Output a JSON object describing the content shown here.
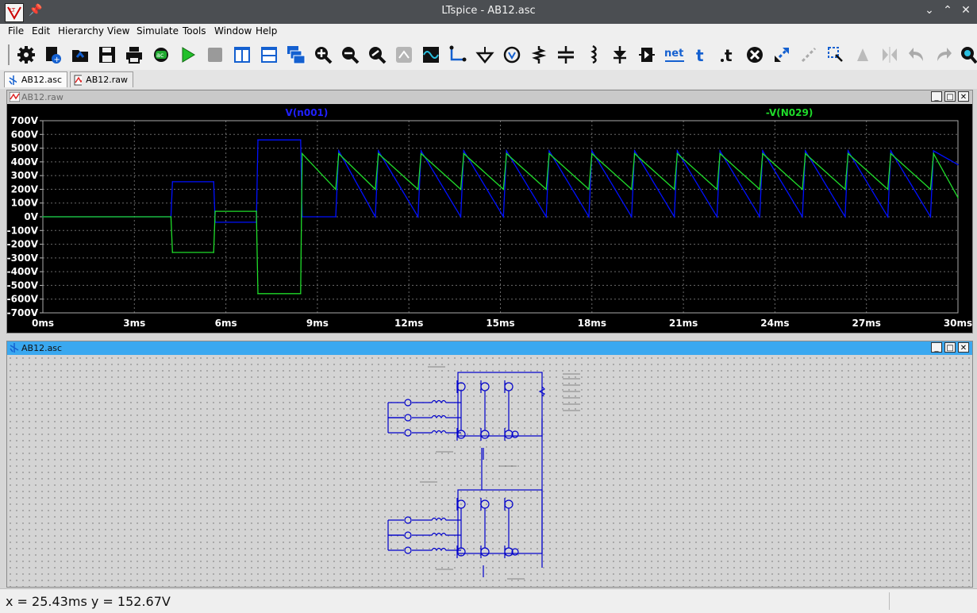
{
  "window": {
    "title": "LTspice - AB12.asc"
  },
  "menu": [
    "File",
    "Edit",
    "Hierarchy",
    "View",
    "Simulate",
    "Tools",
    "Window",
    "Help"
  ],
  "toolbar": {
    "buttons": [
      "control-panel",
      "new-schematic",
      "open",
      "save",
      "print",
      "netlist",
      "run",
      "halt",
      "tile-vertical",
      "tile-horizontal",
      "cascade",
      "zoom-in",
      "zoom-out",
      "zoom-fit",
      "autorange",
      "sine-source",
      "wire",
      "ground",
      "voltage-source",
      "resistor",
      "capacitor",
      "inductor",
      "diode",
      "component",
      "net-label",
      "text",
      "spice-directive",
      "delete",
      "move",
      "drag",
      "undo-redo",
      "rotate",
      "mirror",
      "undo",
      "redo",
      "find"
    ],
    "net_label": "net"
  },
  "tabs": [
    {
      "label": "AB12.asc",
      "active": true
    },
    {
      "label": "AB12.raw",
      "active": false
    }
  ],
  "waveform_window": {
    "title": "AB12.raw"
  },
  "schematic_window": {
    "title": "AB12.asc"
  },
  "status": {
    "coords": "x = 25.43ms    y = 152.67V"
  },
  "colors": {
    "trace1": "#0010ff",
    "trace2": "#1fdc2a",
    "plot_bg": "#000000",
    "axis_text": "#ffffff",
    "label1": "#2020ff",
    "label2": "#1fdc2a",
    "schematic_wire": "#0000cc",
    "accent_cap": "#3aa8f0"
  },
  "chart_data": {
    "type": "line",
    "title": "",
    "xlabel": "",
    "ylabel": "",
    "xlim": [
      0,
      30
    ],
    "ylim": [
      -700,
      700
    ],
    "x_ticks": [
      "0ms",
      "3ms",
      "6ms",
      "9ms",
      "12ms",
      "15ms",
      "18ms",
      "21ms",
      "24ms",
      "27ms",
      "30ms"
    ],
    "y_ticks": [
      "700V",
      "600V",
      "500V",
      "400V",
      "300V",
      "200V",
      "100V",
      "0V",
      "-100V",
      "-200V",
      "-300V",
      "-400V",
      "-500V",
      "-600V",
      "-700V"
    ],
    "grid": true,
    "series": [
      {
        "name": "V(n001)",
        "color": "#0010ff",
        "x": [
          0,
          4.2,
          4.25,
          5.6,
          5.65,
          7.0,
          7.05,
          8.45,
          8.5,
          9.6,
          9.7,
          10.9,
          11.0,
          12.3,
          12.4,
          13.7,
          13.8,
          15.1,
          15.2,
          16.5,
          16.6,
          17.9,
          18.0,
          19.3,
          19.4,
          20.7,
          20.8,
          22.1,
          22.2,
          23.5,
          23.6,
          24.9,
          25.0,
          26.3,
          26.4,
          27.7,
          27.8,
          29.1,
          29.2,
          30.0
        ],
        "y": [
          0,
          0,
          255,
          255,
          -40,
          -40,
          560,
          560,
          0,
          0,
          480,
          0,
          480,
          0,
          480,
          0,
          480,
          0,
          480,
          0,
          480,
          0,
          480,
          0,
          480,
          0,
          480,
          0,
          480,
          0,
          480,
          0,
          480,
          0,
          480,
          0,
          480,
          0,
          480,
          380
        ]
      },
      {
        "name": "-V(N029)",
        "color": "#1fdc2a",
        "x": [
          0,
          4.2,
          4.25,
          5.6,
          5.65,
          7.0,
          7.05,
          8.45,
          8.5,
          9.6,
          9.7,
          10.9,
          11.0,
          12.3,
          12.4,
          13.7,
          13.8,
          15.1,
          15.2,
          16.5,
          16.6,
          17.9,
          18.0,
          19.3,
          19.4,
          20.7,
          20.8,
          22.1,
          22.2,
          23.5,
          23.6,
          24.9,
          25.0,
          26.3,
          26.4,
          27.7,
          27.8,
          29.1,
          29.2,
          30.0
        ],
        "y": [
          0,
          0,
          -260,
          -260,
          40,
          40,
          -560,
          -560,
          460,
          200,
          460,
          200,
          460,
          200,
          460,
          200,
          460,
          200,
          460,
          200,
          460,
          200,
          460,
          200,
          460,
          200,
          460,
          200,
          460,
          200,
          460,
          200,
          460,
          200,
          460,
          200,
          460,
          200,
          460,
          140
        ]
      }
    ]
  }
}
